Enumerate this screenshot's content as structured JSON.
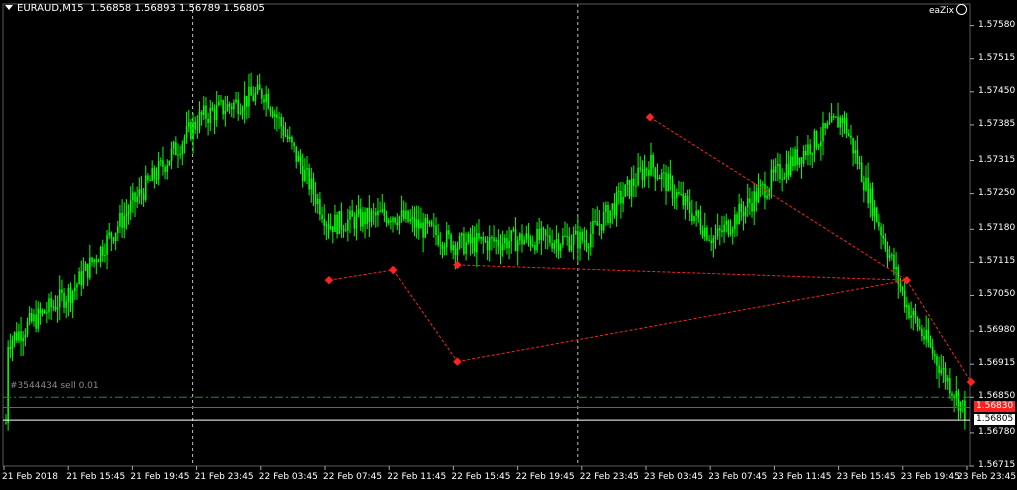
{
  "header": {
    "symbol": "EURAUD,M15",
    "ohlc": "1.56858 1.56893 1.56789 1.56805"
  },
  "ea_label": "eaZix",
  "order_label": "#3544434 sell 0.01",
  "colors": {
    "background": "#000000",
    "bull": "#00ff00",
    "bear": "#00ff00",
    "pattern": "#ff2222",
    "level": "#ff2020",
    "bid": "#ffffff",
    "separator": "#c0c0c0",
    "dash_level": "#2e8b2e"
  },
  "chart_data": {
    "type": "candlestick",
    "symbol": "EURAUD",
    "timeframe": "M15",
    "ylim": [
      1.56715,
      1.57595
    ],
    "y_ticks": [
      "1.57580",
      "1.57515",
      "1.57450",
      "1.57385",
      "1.57315",
      "1.57250",
      "1.57180",
      "1.57115",
      "1.57050",
      "1.56980",
      "1.56915",
      "1.56850",
      "1.56780",
      "1.56715"
    ],
    "x_labels": [
      "21 Feb 2018",
      "21 Feb 15:45",
      "21 Feb 19:45",
      "21 Feb 23:45",
      "22 Feb 03:45",
      "22 Feb 07:45",
      "22 Feb 11:45",
      "22 Feb 15:45",
      "22 Feb 19:45",
      "22 Feb 23:45",
      "23 Feb 03:45",
      "23 Feb 07:45",
      "23 Feb 11:45",
      "23 Feb 15:45",
      "23 Feb 19:45",
      "23 Feb 23:45"
    ],
    "day_separators": [
      "21 Feb 23:45",
      "22 Feb 23:45"
    ],
    "current_price": "1.56805",
    "level_price": "1.56830",
    "dash_level_price": 1.5685,
    "close_path": [
      [
        "21 Feb 2018",
        1.5696
      ],
      [
        "21 Feb 15:45",
        1.5706
      ],
      [
        "21 Feb 19:45",
        1.5724
      ],
      [
        "21 Feb 23:45",
        1.574
      ],
      [
        "22 Feb 03:45",
        1.5745
      ],
      [
        "22 Feb 07:45",
        1.5719
      ],
      [
        "22 Feb 11:45",
        1.5721
      ],
      [
        "22 Feb 15:45",
        1.5715
      ],
      [
        "22 Feb 19:45",
        1.5716
      ],
      [
        "22 Feb 23:45",
        1.5716
      ],
      [
        "23 Feb 03:45",
        1.5731
      ],
      [
        "23 Feb 07:45",
        1.5716
      ],
      [
        "23 Feb 11:45",
        1.5729
      ],
      [
        "23 Feb 15:45",
        1.574
      ],
      [
        "23 Feb 19:45",
        1.5703
      ],
      [
        "23 Feb 23:45",
        1.568
      ]
    ],
    "pattern_points": [
      [
        "22 Feb 07:45",
        1.5708
      ],
      [
        "22 Feb 11:45",
        1.571
      ],
      [
        "22 Feb 15:45",
        1.5692
      ],
      [
        "22 Feb 15:45",
        1.5711
      ],
      [
        "23 Feb 03:45",
        1.574
      ],
      [
        "23 Feb 19:45",
        1.5708
      ],
      [
        "23 Feb 23:45",
        1.5688
      ]
    ]
  }
}
